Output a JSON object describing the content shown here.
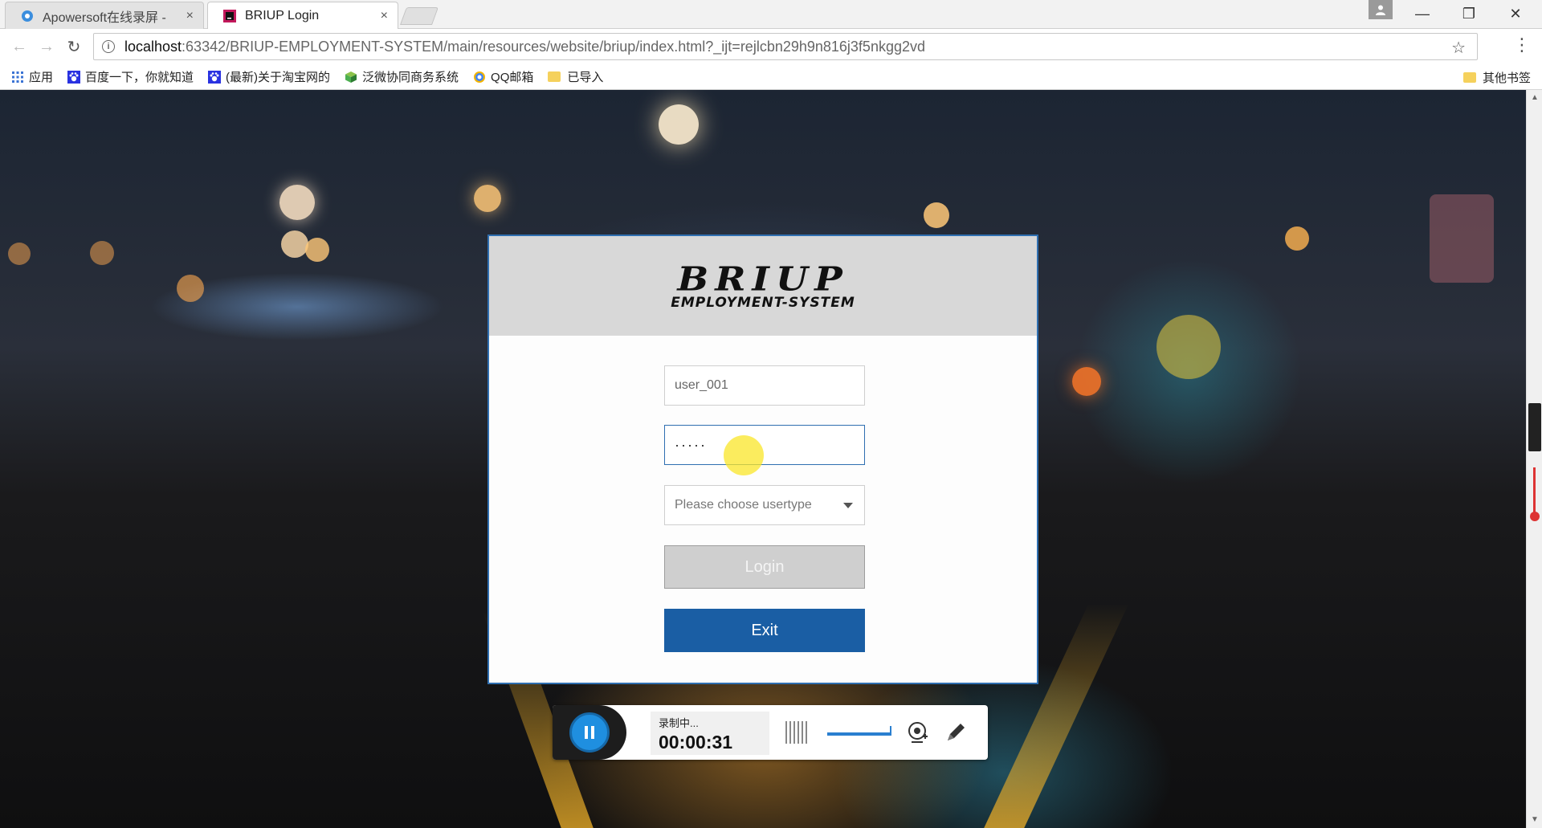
{
  "browser": {
    "tabs": [
      {
        "label": "Apowersoft在线录屏 - ",
        "close": "×"
      },
      {
        "label": "BRIUP Login",
        "close": "×"
      }
    ],
    "url": {
      "host": "localhost",
      "path": ":63342/BRIUP-EMPLOYMENT-SYSTEM/main/resources/website/briup/index.html?_ijt=rejlcbn29h9n816j3f5nkgg2vd"
    },
    "window_buttons": {
      "minimize": "—",
      "restore": "❐",
      "close": "✕"
    },
    "bookmarks": [
      {
        "label": "应用",
        "icon": "apps-grid-icon"
      },
      {
        "label": "百度一下，你就知道",
        "icon": "baidu-paw-icon"
      },
      {
        "label": "(最新)关于淘宝网的",
        "icon": "baidu-paw-icon"
      },
      {
        "label": "泛微协同商务系统",
        "icon": "cube-icon"
      },
      {
        "label": "QQ邮箱",
        "icon": "qq-mail-icon"
      },
      {
        "label": "已导入",
        "icon": "folder-icon"
      }
    ],
    "bookmarks_other": "其他书签"
  },
  "login": {
    "logo_main": "BRIUP",
    "logo_sub": "EMPLOYMENT-SYSTEM",
    "username_value": "user_001",
    "password_value": "·····",
    "usertype_placeholder": "Please choose usertype",
    "login_label": "Login",
    "exit_label": "Exit"
  },
  "recorder": {
    "status": "录制中...",
    "time": "00:00:31"
  },
  "colors": {
    "accent": "#1a5ea4",
    "panel_border": "#2f6fb1",
    "login_button": "#cfcfcf",
    "recorder_pause": "#1f8fe0"
  }
}
